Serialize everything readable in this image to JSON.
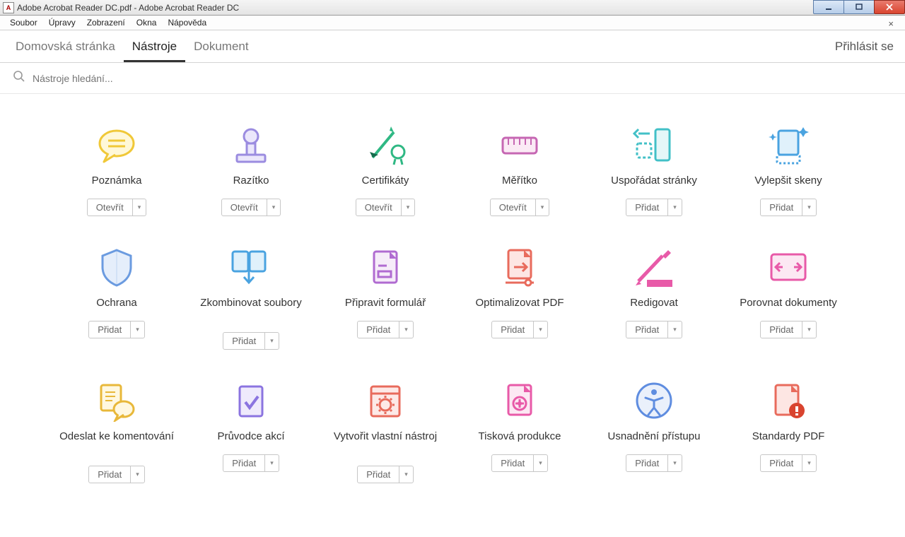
{
  "window": {
    "title": "Adobe Acrobat Reader DC.pdf - Adobe Acrobat Reader DC"
  },
  "menu": {
    "items": [
      "Soubor",
      "Úpravy",
      "Zobrazení",
      "Okna",
      "Nápověda"
    ]
  },
  "tabs": {
    "home": "Domovská stránka",
    "tools": "Nástroje",
    "document": "Dokument",
    "signin": "Přihlásit se"
  },
  "search": {
    "placeholder": "Nástroje hledání..."
  },
  "btn": {
    "open": "Otevřít",
    "add": "Přidat"
  },
  "tools": [
    {
      "name": "comment",
      "label": "Poznámka",
      "action": "open",
      "icon": "comment"
    },
    {
      "name": "stamp",
      "label": "Razítko",
      "action": "open",
      "icon": "stamp"
    },
    {
      "name": "cert",
      "label": "Certifikáty",
      "action": "open",
      "icon": "cert"
    },
    {
      "name": "measure",
      "label": "Měřítko",
      "action": "open",
      "icon": "measure"
    },
    {
      "name": "organize",
      "label": "Uspořádat stránky",
      "action": "add",
      "icon": "organize"
    },
    {
      "name": "enhance",
      "label": "Vylepšit skeny",
      "action": "add",
      "icon": "enhance"
    },
    {
      "name": "protect",
      "label": "Ochrana",
      "action": "add",
      "icon": "protect"
    },
    {
      "name": "combine",
      "label": "Zkombinovat soubory",
      "action": "add",
      "icon": "combine",
      "two": true
    },
    {
      "name": "prepare",
      "label": "Připravit formulář",
      "action": "add",
      "icon": "prepare"
    },
    {
      "name": "optimize",
      "label": "Optimalizovat PDF",
      "action": "add",
      "icon": "optimize"
    },
    {
      "name": "redact",
      "label": "Redigovat",
      "action": "add",
      "icon": "redact"
    },
    {
      "name": "compare",
      "label": "Porovnat dokumenty",
      "action": "add",
      "icon": "compare"
    },
    {
      "name": "send",
      "label": "Odeslat ke komentování",
      "action": "add",
      "icon": "send",
      "two": true
    },
    {
      "name": "wizard",
      "label": "Průvodce akcí",
      "action": "add",
      "icon": "wizard"
    },
    {
      "name": "custom",
      "label": "Vytvořit vlastní nástroj",
      "action": "add",
      "icon": "custom",
      "two": true
    },
    {
      "name": "print",
      "label": "Tisková produkce",
      "action": "add",
      "icon": "print"
    },
    {
      "name": "access",
      "label": "Usnadnění přístupu",
      "action": "add",
      "icon": "access"
    },
    {
      "name": "standards",
      "label": "Standardy PDF",
      "action": "add",
      "icon": "standards"
    }
  ]
}
